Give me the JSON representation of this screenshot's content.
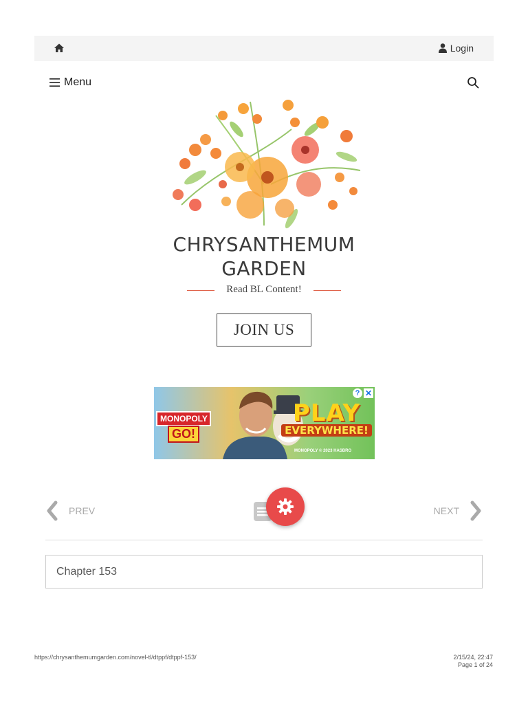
{
  "topbar": {
    "home_icon": "home-icon",
    "login_icon": "user-icon",
    "login_label": "Login"
  },
  "header": {
    "menu_label": "Menu",
    "menu_icon": "hamburger-icon",
    "search_icon": "search-icon"
  },
  "branding": {
    "logo": "watercolor-flower-bouquet",
    "title": "CHRYSANTHEMUM GARDEN",
    "tagline": "Read BL Content!",
    "join_label": "JOIN US",
    "accent_color": "#e0624a"
  },
  "ad": {
    "brand_line1": "MONOPOLY",
    "brand_line2": "GO!",
    "headline": "PLAY",
    "subheadline": "EVERYWHERE!",
    "copyright": "MONOPOLY © 2023 HASBRO"
  },
  "chapter_nav": {
    "prev_label": "PREV",
    "next_label": "NEXT",
    "index_icon": "list-icon",
    "settings_icon": "gear-icon",
    "fab_color": "#e84a4a"
  },
  "chapter": {
    "title": "Chapter 153"
  },
  "print_footer": {
    "url": "https://chrysanthemumgarden.com/novel-tl/dtppf/dtppf-153/",
    "datetime": "2/15/24, 22:47",
    "page": "Page 1 of 24"
  }
}
